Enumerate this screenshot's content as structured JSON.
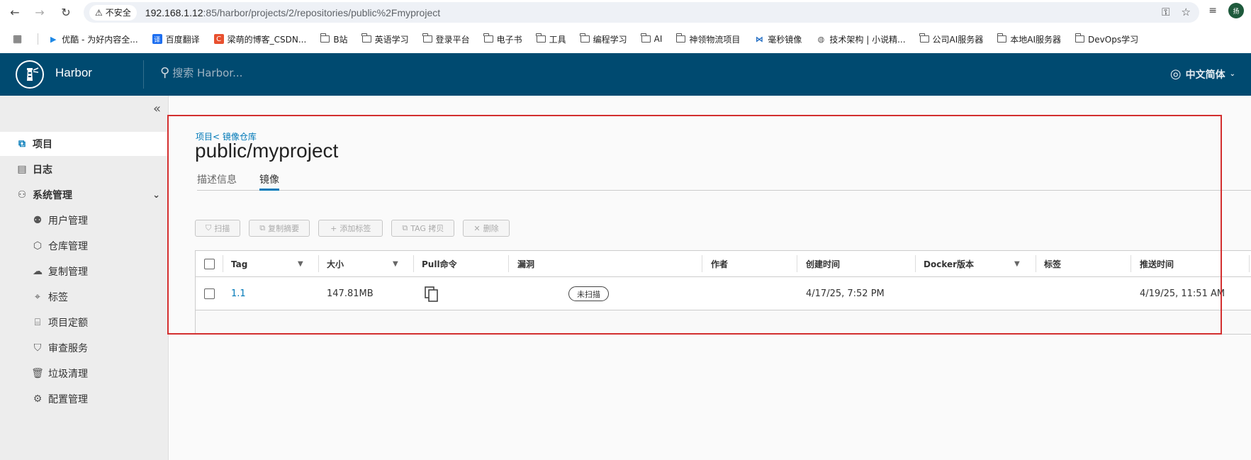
{
  "browser": {
    "insecure_label": "不安全",
    "url_host": "192.168.1.12",
    "url_rest": ":85/harbor/projects/2/repositories/public%2Fmyproject",
    "profile_initial": "扬"
  },
  "bookmarks": [
    {
      "label": "优酷 - 为好内容全...",
      "icon": "youku-icon"
    },
    {
      "label": "百度翻译",
      "icon": "translate-icon"
    },
    {
      "label": "梁萌的博客_CSDN...",
      "icon": "csdn-icon"
    },
    {
      "label": "B站",
      "icon": "folder-icon"
    },
    {
      "label": "英语学习",
      "icon": "folder-icon"
    },
    {
      "label": "登录平台",
      "icon": "folder-icon"
    },
    {
      "label": "电子书",
      "icon": "folder-icon"
    },
    {
      "label": "工具",
      "icon": "folder-icon"
    },
    {
      "label": "编程学习",
      "icon": "folder-icon"
    },
    {
      "label": "AI",
      "icon": "folder-icon"
    },
    {
      "label": "神领物流项目",
      "icon": "folder-icon"
    },
    {
      "label": "毫秒镜像",
      "icon": "mirror-icon"
    },
    {
      "label": "技术架构 | 小说精...",
      "icon": "globe-icon"
    },
    {
      "label": "公司AI服务器",
      "icon": "folder-icon"
    },
    {
      "label": "本地AI服务器",
      "icon": "folder-icon"
    },
    {
      "label": "DevOps学习",
      "icon": "folder-icon"
    }
  ],
  "header": {
    "app_title": "Harbor",
    "search_placeholder": "搜索 Harbor...",
    "language": "中文简体"
  },
  "sidebar": {
    "items": [
      {
        "label": "项目",
        "icon": "projects-icon"
      },
      {
        "label": "日志",
        "icon": "logs-icon"
      },
      {
        "label": "系统管理",
        "icon": "admin-icon"
      },
      {
        "label": "用户管理",
        "icon": "users-icon"
      },
      {
        "label": "仓库管理",
        "icon": "registry-icon"
      },
      {
        "label": "复制管理",
        "icon": "replication-icon"
      },
      {
        "label": "标签",
        "icon": "tag-icon"
      },
      {
        "label": "项目定额",
        "icon": "quota-icon"
      },
      {
        "label": "审查服务",
        "icon": "shield-icon"
      },
      {
        "label": "垃圾清理",
        "icon": "trash-icon"
      },
      {
        "label": "配置管理",
        "icon": "gear-icon"
      }
    ]
  },
  "main": {
    "breadcrumb": "项目< 镜像仓库",
    "title": "public/myproject",
    "tabs": [
      "描述信息",
      "镜像"
    ],
    "toolbar": {
      "scan": "扫描",
      "copy_digest": "复制摘要",
      "add_label": "添加标签",
      "tag_copy": "TAG 拷贝",
      "delete": "删除"
    },
    "table": {
      "headers": [
        "Tag",
        "大小",
        "Pull命令",
        "漏洞",
        "作者",
        "创建时间",
        "Docker版本",
        "标签",
        "推送时间"
      ],
      "rows": [
        {
          "tag": "1.1",
          "size": "147.81MB",
          "vulnerability": "未扫描",
          "author": "",
          "created": "4/17/25, 7:52 PM",
          "docker_version": "",
          "labels": "",
          "pushed": "4/19/25, 11:51 AM"
        }
      ]
    }
  },
  "colors": {
    "header_bg": "#004a70",
    "accent": "#0079b8",
    "highlight_border": "#d32f2f"
  }
}
